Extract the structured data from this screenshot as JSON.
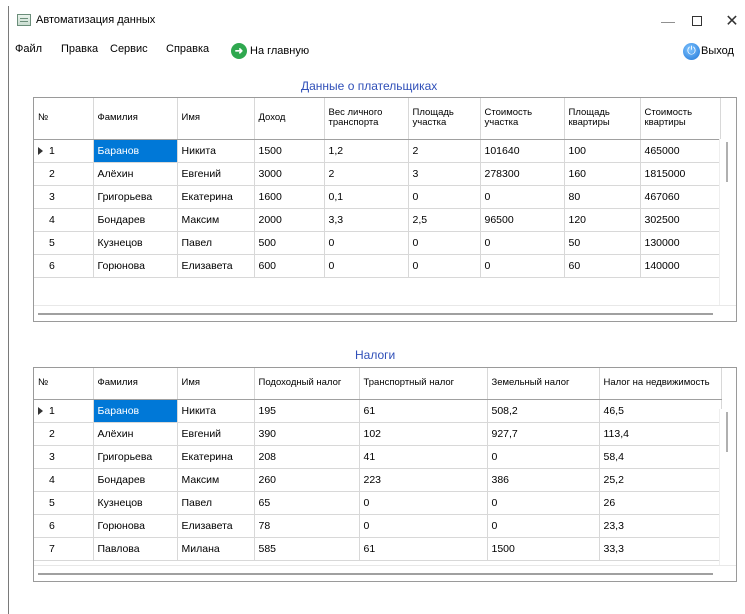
{
  "window": {
    "title": "Автоматизация данных",
    "minimize": "—",
    "close": "✕"
  },
  "menu": {
    "items": [
      "Файл",
      "Правка",
      "Сервис",
      "Справка"
    ],
    "home_label": "На главную",
    "exit_label": "Выход"
  },
  "payers": {
    "title": "Данные о плательщиках",
    "columns": [
      "№",
      "Фамилия",
      "Имя",
      "Доход",
      "Вес личного транспорта",
      "Площадь участка",
      "Стоимость участка",
      "Площадь квартиры",
      "Стоимость квартиры"
    ],
    "rows": [
      [
        "1",
        "Баранов",
        "Никита",
        "1500",
        "1,2",
        "2",
        "101640",
        "100",
        "465000"
      ],
      [
        "2",
        "Алёхин",
        "Евгений",
        "3000",
        "2",
        "3",
        "278300",
        "160",
        "1815000"
      ],
      [
        "3",
        "Григорьева",
        "Екатерина",
        "1600",
        "0,1",
        "0",
        "0",
        "80",
        "467060"
      ],
      [
        "4",
        "Бондарев",
        "Максим",
        "2000",
        "3,3",
        "2,5",
        "96500",
        "120",
        "302500"
      ],
      [
        "5",
        "Кузнецов",
        "Павел",
        "500",
        "0",
        "0",
        "0",
        "50",
        "130000"
      ],
      [
        "6",
        "Горюнова",
        "Елизавета",
        "600",
        "0",
        "0",
        "0",
        "60",
        "140000"
      ]
    ]
  },
  "taxes": {
    "title": "Налоги",
    "columns": [
      "№",
      "Фамилия",
      "Имя",
      "Подоходный налог",
      "Транспортный налог",
      "Земельный налог",
      "Налог на недвижимость"
    ],
    "rows": [
      [
        "1",
        "Баранов",
        "Никита",
        "195",
        "61",
        "508,2",
        "46,5"
      ],
      [
        "2",
        "Алёхин",
        "Евгений",
        "390",
        "102",
        "927,7",
        "113,4"
      ],
      [
        "3",
        "Григорьева",
        "Екатерина",
        "208",
        "41",
        "0",
        "58,4"
      ],
      [
        "4",
        "Бондарев",
        "Максим",
        "260",
        "223",
        "386",
        "25,2"
      ],
      [
        "5",
        "Кузнецов",
        "Павел",
        "65",
        "0",
        "0",
        "26"
      ],
      [
        "6",
        "Горюнова",
        "Елизавета",
        "78",
        "0",
        "0",
        "23,3"
      ],
      [
        "7",
        "Павлова",
        "Милана",
        "585",
        "61",
        "1500",
        "33,3"
      ]
    ]
  },
  "colors": {
    "accent": "#0078d7",
    "section_title": "#2f4fb8"
  }
}
